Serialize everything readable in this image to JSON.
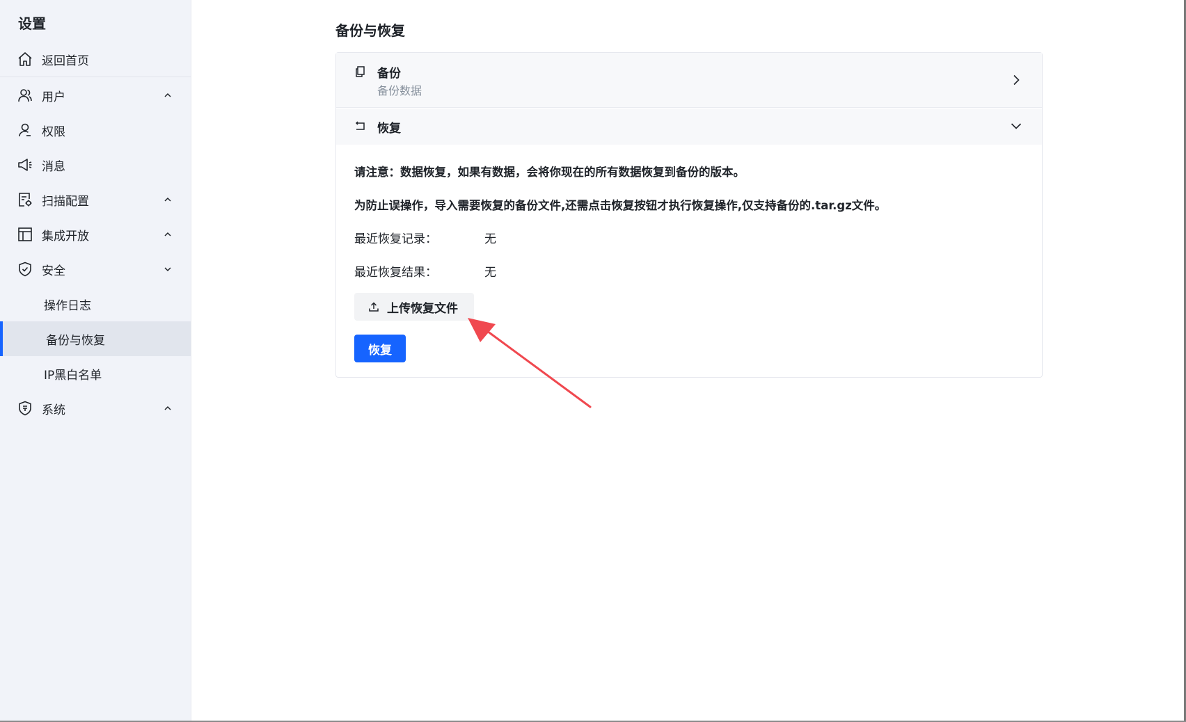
{
  "sidebar": {
    "title": "设置",
    "home": "返回首页",
    "items": [
      {
        "label": "用户"
      },
      {
        "label": "权限"
      },
      {
        "label": "消息"
      },
      {
        "label": "扫描配置"
      },
      {
        "label": "集成开放"
      },
      {
        "label": "安全"
      },
      {
        "label": "操作日志"
      },
      {
        "label": "备份与恢复"
      },
      {
        "label": "IP黑白名单"
      },
      {
        "label": "系统"
      }
    ]
  },
  "main": {
    "title": "备份与恢复",
    "backup": {
      "title": "备份",
      "subtitle": "备份数据"
    },
    "restore": {
      "title": "恢复",
      "notice1": "请注意：数据恢复，如果有数据，会将你现在的所有数据恢复到备份的版本。",
      "notice2": "为防止误操作，导入需要恢复的备份文件,还需点击恢复按钮才执行恢复操作,仅支持备份的.tar.gz文件。",
      "recent_record_label": "最近恢复记录：",
      "recent_record_value": "无",
      "recent_result_label": "最近恢复结果：",
      "recent_result_value": "无",
      "upload_label": "上传恢复文件",
      "restore_button": "恢复"
    }
  },
  "colors": {
    "accent": "#1664ff",
    "sidebar_bg": "#f1f3f9",
    "annotation_arrow": "#f0484f"
  }
}
